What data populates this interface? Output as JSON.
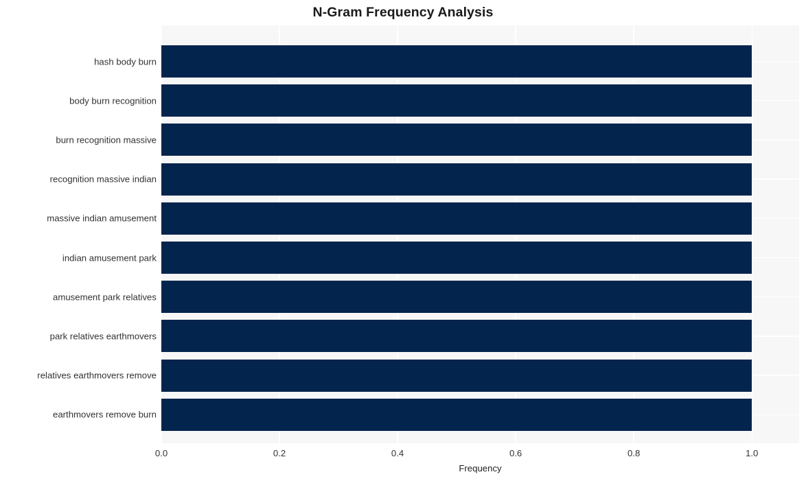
{
  "chart_data": {
    "type": "bar",
    "orientation": "horizontal",
    "title": "N-Gram Frequency Analysis",
    "xlabel": "Frequency",
    "ylabel": "",
    "categories": [
      "hash body burn",
      "body burn recognition",
      "burn recognition massive",
      "recognition massive indian",
      "massive indian amusement",
      "indian amusement park",
      "amusement park relatives",
      "park relatives earthmovers",
      "relatives earthmovers remove",
      "earthmovers remove burn"
    ],
    "values": [
      1.0,
      1.0,
      1.0,
      1.0,
      1.0,
      1.0,
      1.0,
      1.0,
      1.0,
      1.0
    ],
    "xlim": [
      0.0,
      1.08
    ],
    "xticks": [
      "0.0",
      "0.2",
      "0.4",
      "0.6",
      "0.8",
      "1.0"
    ],
    "xtick_values": [
      0.0,
      0.2,
      0.4,
      0.6,
      0.8,
      1.0
    ],
    "grid": true,
    "legend": null,
    "bar_color": "#03244d",
    "plot_background": "#f7f7f7",
    "figure_background": "#ffffff",
    "gridline_color": "#ffffff"
  }
}
